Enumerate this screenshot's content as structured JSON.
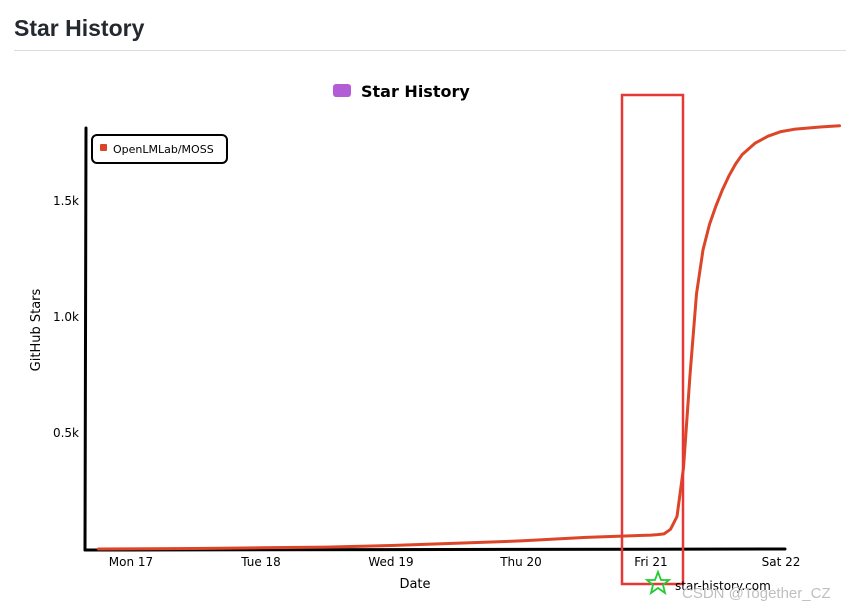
{
  "section": {
    "title": "Star History"
  },
  "chart_data": {
    "type": "line",
    "title": "Star History",
    "xlabel": "Date",
    "ylabel": "GitHub Stars",
    "x_ticks": [
      "Mon 17",
      "Tue 18",
      "Wed 19",
      "Thu 20",
      "Fri 21",
      "Sat 22"
    ],
    "y_ticks": [
      "0.5k",
      "1.0k",
      "1.5k"
    ],
    "ylim": [
      0,
      1850
    ],
    "xlim": [
      0,
      5.45
    ],
    "series": [
      {
        "name": "OpenLMLab/MOSS",
        "color": "#dd4528",
        "x": [
          -0.25,
          0.5,
          1.0,
          1.5,
          2.0,
          2.5,
          3.0,
          3.5,
          4.0,
          4.05,
          4.1,
          4.15,
          4.2,
          4.25,
          4.3,
          4.35,
          4.4,
          4.45,
          4.5,
          4.55,
          4.6,
          4.65,
          4.7,
          4.8,
          4.9,
          5.0,
          5.1,
          5.2,
          5.3,
          5.45
        ],
        "values": [
          0,
          2,
          5,
          8,
          15,
          25,
          35,
          50,
          60,
          62,
          65,
          85,
          140,
          350,
          750,
          1100,
          1290,
          1400,
          1480,
          1550,
          1610,
          1660,
          1700,
          1750,
          1780,
          1800,
          1810,
          1815,
          1820,
          1825
        ]
      }
    ],
    "legend_position": "top-left",
    "grid": false,
    "brand": "star-history.com"
  },
  "annotation": {
    "type": "highlight-box",
    "color": "#e53935",
    "x_from": 4.05,
    "x_to": 4.5
  },
  "watermark": "CSDN @Together_CZ"
}
